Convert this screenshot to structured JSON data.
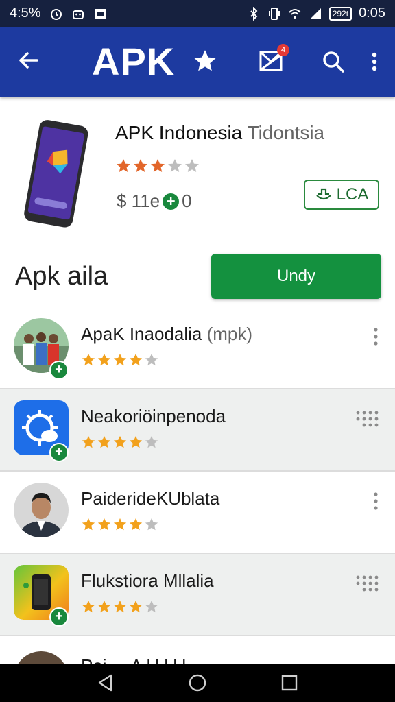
{
  "status_bar": {
    "battery_percent": "4:5%",
    "battery_label": "292t",
    "time": "0:05",
    "icons": [
      "alarm-icon",
      "bot-icon",
      "image-icon",
      "bluetooth-icon",
      "vibrate-icon",
      "wifi-icon",
      "signal-icon",
      "battery-icon"
    ]
  },
  "app_bar": {
    "title": "APK",
    "notification_count": "4",
    "icons": [
      "back-arrow-icon",
      "star-icon",
      "inbox-icon",
      "search-icon",
      "more-vert-icon"
    ]
  },
  "hero": {
    "app_name": "APK Indonesia",
    "app_name_suffix": "Tidontsia",
    "rating": 3,
    "rating_max": 5,
    "price_prefix": "$ 11e",
    "price_suffix": "0",
    "action_label": "LCA"
  },
  "section": {
    "title": "Apk aila",
    "button_label": "Undy"
  },
  "list": {
    "items": [
      {
        "title": "ApaK Inaodalia",
        "suffix": "(mpk)",
        "rating": 4,
        "avatar": "group-photo"
      },
      {
        "title": "Neakoriöinpenoda",
        "suffix": "",
        "rating": 4,
        "avatar": "blue-app-icon"
      },
      {
        "title": "PaiderideKUblata",
        "suffix": "",
        "rating": 4,
        "avatar": "person-photo"
      },
      {
        "title": "Flukstiora Mllalia",
        "suffix": "",
        "rating": 4,
        "avatar": "phone-app-icon"
      }
    ],
    "partial_item_title": "Pai ... A U l l l"
  },
  "colors": {
    "status_bar": "#16213f",
    "app_bar": "#1d3aa0",
    "primary_green": "#14913f",
    "star_filled": "#f2a11c",
    "star_empty": "#bdbdbd"
  }
}
